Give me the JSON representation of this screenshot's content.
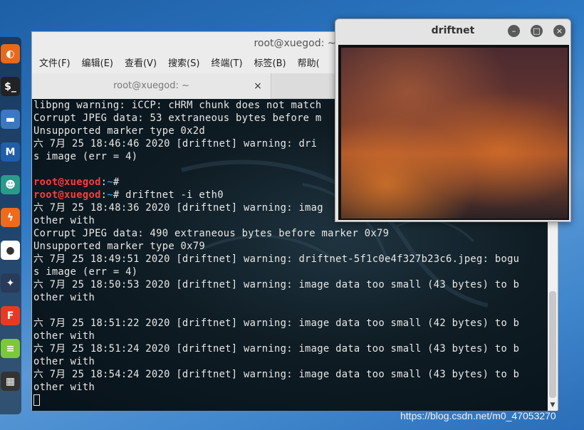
{
  "dock": {
    "items": [
      {
        "icon": "firefox-icon",
        "color": "#e66a1e",
        "glyph": "◐"
      },
      {
        "icon": "terminal-icon",
        "color": "#222222",
        "glyph": "$_"
      },
      {
        "icon": "folder-icon",
        "color": "#3a78c2",
        "glyph": "▬"
      },
      {
        "icon": "metasploit-icon",
        "color": "#1f5ea8",
        "glyph": "M"
      },
      {
        "icon": "armitage-icon",
        "color": "#2a9a8a",
        "glyph": "☻"
      },
      {
        "icon": "burpsuite-icon",
        "color": "#f06a1a",
        "glyph": "ϟ"
      },
      {
        "icon": "maltego-icon",
        "color": "#ffffff",
        "glyph": "●"
      },
      {
        "icon": "beef-icon",
        "color": "#2a3a5a",
        "glyph": "✦"
      },
      {
        "icon": "faraday-icon",
        "color": "#e83a22",
        "glyph": "F"
      },
      {
        "icon": "notes-icon",
        "color": "#7cc83a",
        "glyph": "≡"
      },
      {
        "icon": "apps-grid-icon",
        "color": "#333333",
        "glyph": "▦"
      }
    ]
  },
  "terminal": {
    "title": "root@xuegod: ~",
    "menu": [
      "文件(F)",
      "编辑(E)",
      "查看(V)",
      "搜索(S)",
      "终端(T)",
      "标签(B)",
      "帮助("
    ],
    "tab_label": "root@xuegod: ~",
    "tab_close": "×",
    "prompt_user": "root@xuegod",
    "prompt_sep": ":",
    "prompt_path": "~",
    "prompt_end": "# ",
    "command": "driftnet -i eth0",
    "lines_before": [
      "libpng warning: iCCP: cHRM chunk does not match",
      "Corrupt JPEG data: 53 extraneous bytes before m",
      "Unsupported marker type 0x2d",
      "六 7月 25 18:46:46 2020 [driftnet] warning: dri",
      "s image (err = 4)",
      ""
    ],
    "lines_after": [
      "六 7月 25 18:48:36 2020 [driftnet] warning: imag",
      "other with",
      "Corrupt JPEG data: 490 extraneous bytes before marker 0x79",
      "Unsupported marker type 0x79",
      "六 7月 25 18:49:51 2020 [driftnet] warning: driftnet-5f1c0e4f327b23c6.jpeg: bogu",
      "s image (err = 4)",
      "六 7月 25 18:50:53 2020 [driftnet] warning: image data too small (43 bytes) to b",
      "other with",
      "",
      "六 7月 25 18:51:22 2020 [driftnet] warning: image data too small (42 bytes) to b",
      "other with",
      "六 7月 25 18:51:24 2020 [driftnet] warning: image data too small (43 bytes) to b",
      "other with",
      "六 7月 25 18:54:24 2020 [driftnet] warning: image data too small (43 bytes) to b",
      "other with"
    ]
  },
  "driftnet": {
    "title": "driftnet",
    "minimize": "–",
    "maximize": "□",
    "close": "×"
  },
  "watermark": "https://blog.csdn.net/m0_47053270"
}
